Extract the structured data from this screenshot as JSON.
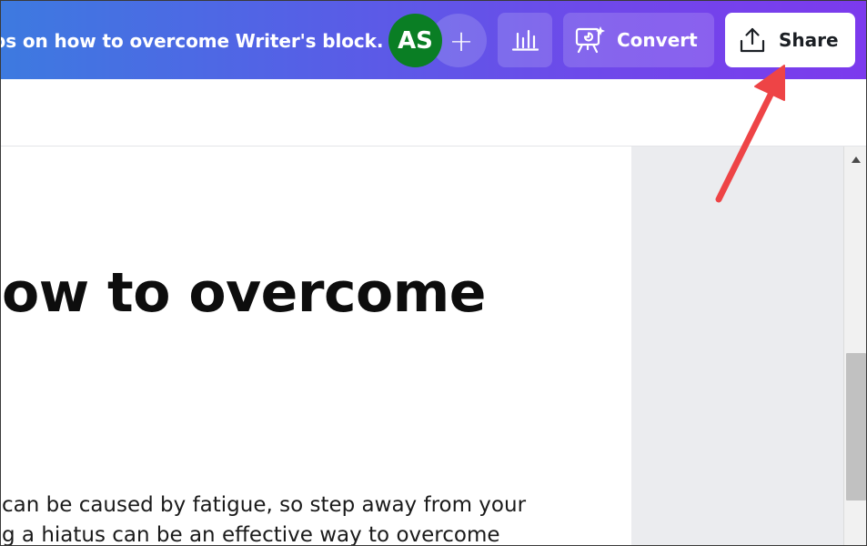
{
  "header": {
    "document_title": "ps on how to overcome Writer's block.",
    "avatar_initials": "AS",
    "add_label": "+",
    "convert_label": "Convert",
    "share_label": "Share"
  },
  "document": {
    "heading": "ow to overcome",
    "body_lines": [
      "can be caused by fatigue, so step away from your",
      "g a hiatus can be an effective way to overcome"
    ]
  },
  "colors": {
    "header_gradient_start": "#3d7ae0",
    "header_gradient_end": "#7c3aed",
    "avatar_bg": "#0a7e24",
    "annotation_arrow": "#ee4446"
  },
  "icons": {
    "insights": "bar-chart-icon",
    "convert": "presentation-sparkle-icon",
    "share": "upload-icon",
    "scroll_up": "triangle-up-icon"
  }
}
